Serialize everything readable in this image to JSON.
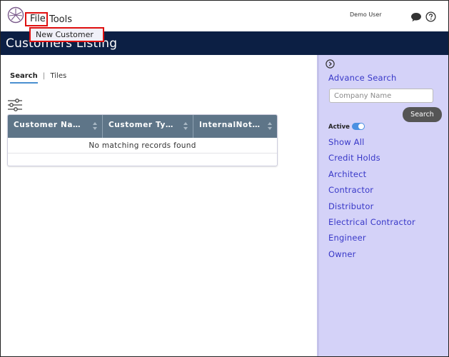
{
  "menu": {
    "file": "File",
    "tools": "Tools",
    "dropdown_item": "New Customer"
  },
  "header": {
    "user": "Demo User",
    "title": "Customers Listing"
  },
  "tabs": {
    "search": "Search",
    "separator": "|",
    "tiles": "Tiles"
  },
  "table": {
    "columns": [
      "Customer Na…",
      "Customer Ty…",
      "InternalNot…"
    ],
    "empty_message": "No matching records found"
  },
  "sidebar": {
    "title": "Advance Search",
    "company_placeholder": "Company Name",
    "search_button": "Search",
    "active_label": "Active",
    "active_on": true,
    "filters": [
      "Show All",
      "Credit Holds",
      "Architect",
      "Contractor",
      "Distributor",
      "Electrical Contractor",
      "Engineer",
      "Owner"
    ]
  },
  "colors": {
    "header_bg": "#0c1f44",
    "table_header": "#5e7588",
    "sidebar_bg": "#d4d2f8",
    "link": "#3838c8",
    "highlight": "#e01010"
  },
  "icons": [
    "logo-icon",
    "chat-icon",
    "help-icon",
    "filter-sliders-icon",
    "sort-icon",
    "collapse-chevron-icon",
    "toggle-switch"
  ]
}
